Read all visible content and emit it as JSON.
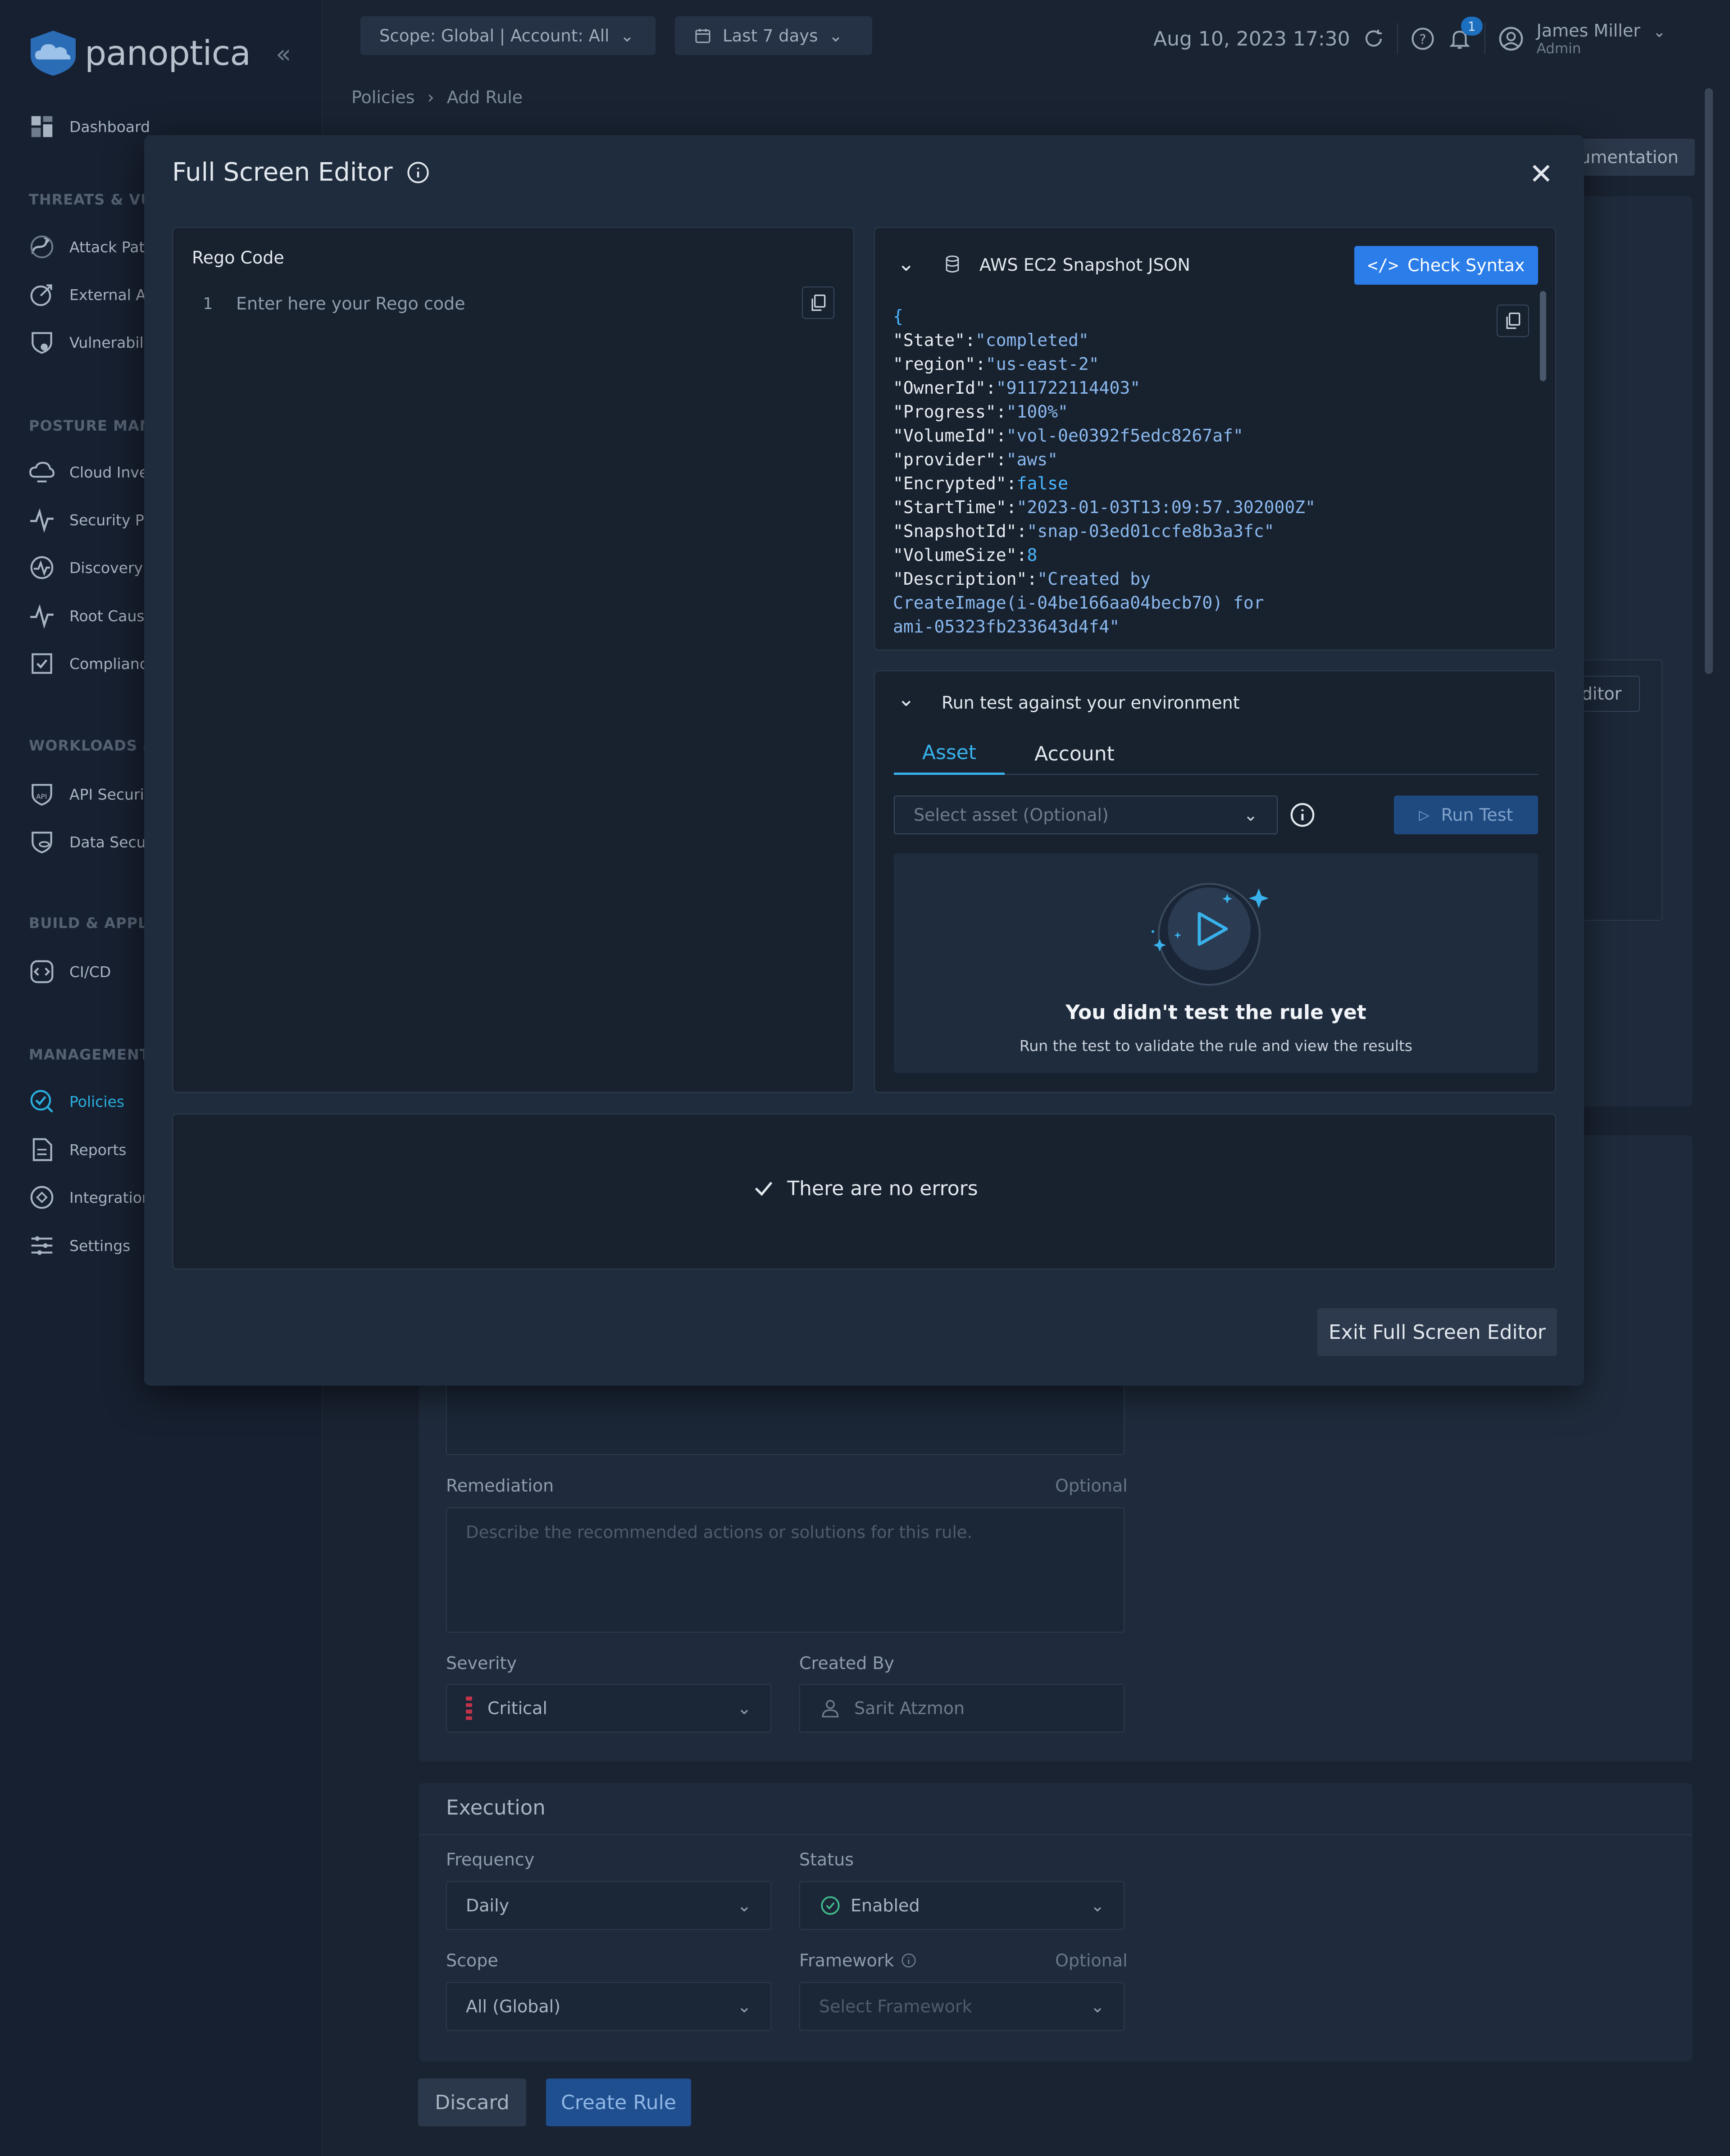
{
  "app": {
    "logo_text": "panoptica"
  },
  "sidebar": {
    "items": [
      {
        "label": "Dashboard",
        "icon": "dashboard-icon"
      },
      {
        "label": "Attack Path",
        "icon": "attack-path-icon"
      },
      {
        "label": "External At",
        "icon": "external-attack-icon"
      },
      {
        "label": "Vulnerabili",
        "icon": "vulnerability-icon"
      },
      {
        "label": "Cloud Inve",
        "icon": "cloud-inventory-icon"
      },
      {
        "label": "Security Po",
        "icon": "security-posture-icon"
      },
      {
        "label": "Discovery",
        "icon": "discovery-icon"
      },
      {
        "label": "Root Caus",
        "icon": "root-cause-icon"
      },
      {
        "label": "Complianc",
        "icon": "compliance-icon"
      },
      {
        "label": "API Securit",
        "icon": "api-security-icon"
      },
      {
        "label": "Data Secur",
        "icon": "data-security-icon"
      },
      {
        "label": "CI/CD",
        "icon": "cicd-icon"
      },
      {
        "label": "Policies",
        "icon": "policies-icon"
      },
      {
        "label": "Reports",
        "icon": "reports-icon"
      },
      {
        "label": "Integration",
        "icon": "integrations-icon"
      },
      {
        "label": "Settings",
        "icon": "settings-icon"
      }
    ],
    "sections": [
      "THREATS & VUL",
      "POSTURE MANA",
      "WORKLOADS &",
      "BUILD & APPLIC",
      "MANAGEMENT"
    ]
  },
  "topbar": {
    "scope": "Scope: Global | Account: All",
    "date_range": "Last 7 days",
    "timestamp": "Aug 10, 2023 17:30",
    "notification_count": "1",
    "user_name": "James Miller",
    "user_role": "Admin"
  },
  "breadcrumb": {
    "parent": "Policies",
    "current": "Add Rule"
  },
  "background": {
    "documentation_label": "umentation",
    "editor_label": "ditor",
    "remediation_label": "Remediation",
    "remediation_optional": "Optional",
    "remediation_placeholder": "Describe the recommended actions or solutions for this rule.",
    "severity_label": "Severity",
    "severity_value": "Critical",
    "created_by_label": "Created By",
    "created_by_value": "Sarit Atzmon",
    "execution_title": "Execution",
    "frequency_label": "Frequency",
    "frequency_value": "Daily",
    "status_label": "Status",
    "status_value": "Enabled",
    "scope_label": "Scope",
    "scope_value": "All (Global)",
    "framework_label": "Framework",
    "framework_optional": "Optional",
    "framework_placeholder": "Select Framework",
    "discard_label": "Discard",
    "create_label": "Create Rule"
  },
  "modal": {
    "title": "Full Screen Editor",
    "rego": {
      "title": "Rego Code",
      "line_number": "1",
      "placeholder": "Enter here your Rego code"
    },
    "json_panel": {
      "title": "AWS EC2 Snapshot JSON",
      "check_syntax": "Check Syntax",
      "open_brace": "{",
      "lines": [
        {
          "key": "\"State\"",
          "value": "\"completed\"",
          "kind": "string"
        },
        {
          "key": "\"region\"",
          "value": "\"us-east-2\"",
          "kind": "string"
        },
        {
          "key": "\"OwnerId\"",
          "value": "\"911722114403\"",
          "kind": "string"
        },
        {
          "key": "\"Progress\"",
          "value": "\"100%\"",
          "kind": "string"
        },
        {
          "key": "\"VolumeId\"",
          "value": "\"vol-0e0392f5edc8267af\"",
          "kind": "string"
        },
        {
          "key": "\"provider\"",
          "value": "\"aws\"",
          "kind": "string"
        },
        {
          "key": "\"Encrypted\"",
          "value": "false",
          "kind": "bool"
        },
        {
          "key": "\"StartTime\"",
          "value": "\"2023-01-03T13:09:57.302000Z\"",
          "kind": "string"
        },
        {
          "key": "\"SnapshotId\"",
          "value": "\"snap-03ed01ccfe8b3a3fc\"",
          "kind": "string"
        },
        {
          "key": "\"VolumeSize\"",
          "value": "8",
          "kind": "bool"
        },
        {
          "key": "\"Description\"",
          "value": "\"Created by",
          "kind": "string"
        }
      ],
      "wrap_lines": [
        "CreateImage(i-04be166aa04becb70) for",
        "ami-05323fb233643d4f4\""
      ]
    },
    "test_panel": {
      "title": "Run test against your environment",
      "tabs": [
        "Asset",
        "Account"
      ],
      "active_tab": "Asset",
      "select_placeholder": "Select asset (Optional)",
      "run_test": "Run Test",
      "empty_title": "You didn't test the rule yet",
      "empty_subtitle": "Run the test to validate the rule and view the results"
    },
    "errors": {
      "message": "There are no errors"
    },
    "exit_button": "Exit Full Screen Editor"
  },
  "colors": {
    "accent": "#2b7de9",
    "active_nav": "#2ab0e0",
    "severity_critical": "#c2334a",
    "status_enabled": "#3fb98a"
  }
}
